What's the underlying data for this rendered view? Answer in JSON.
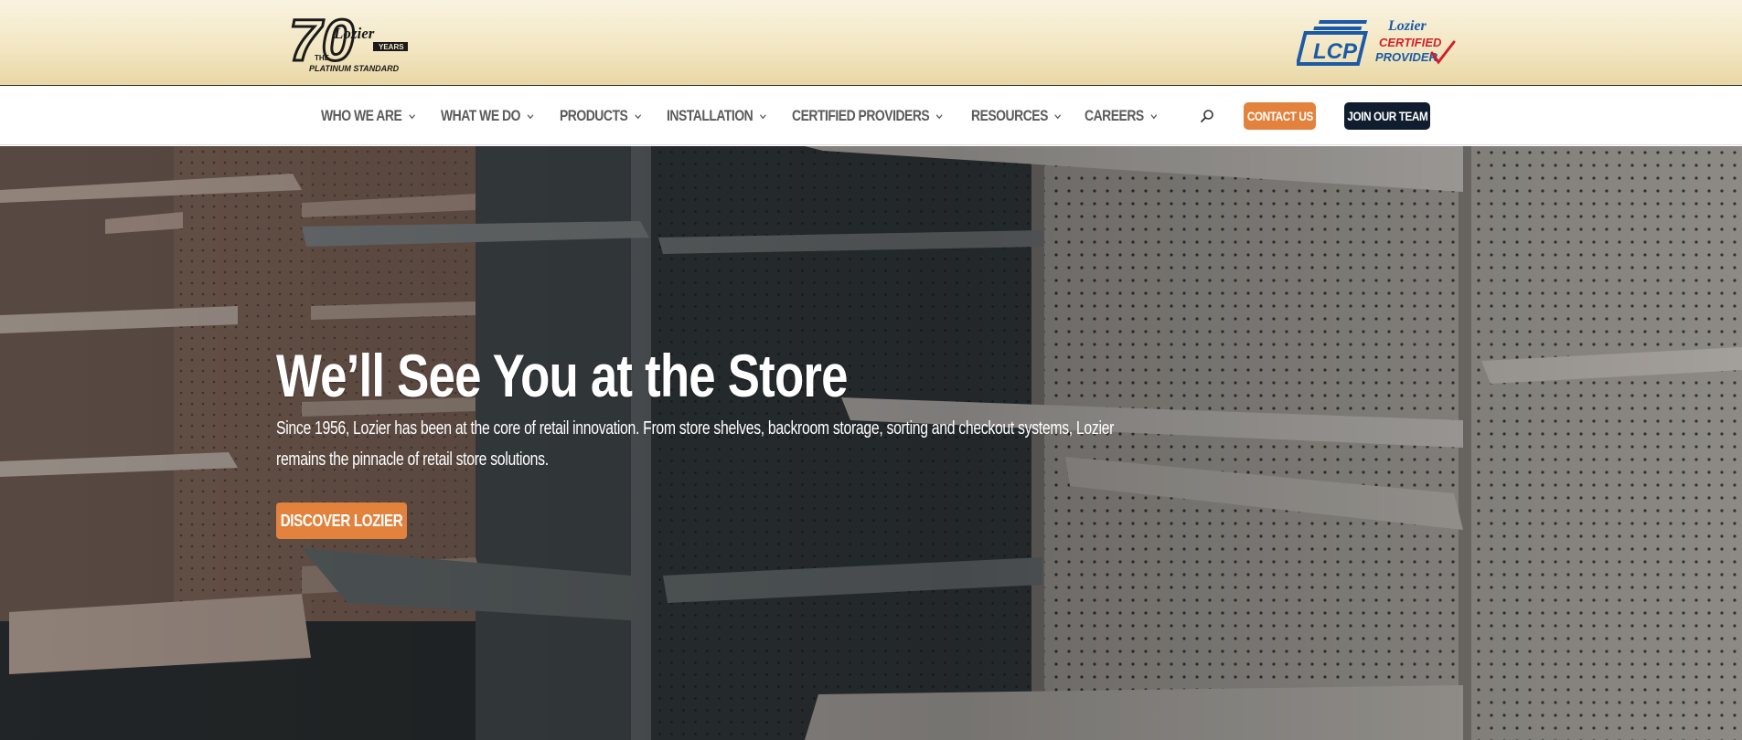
{
  "brand": {
    "logo_number": "70",
    "logo_name": "Lozier",
    "logo_years": "YEARS",
    "logo_the": "THE",
    "logo_tagline": "PLATINUM STANDARD",
    "lcp_initials": "LCP",
    "lcp_name": "Lozier",
    "lcp_line1": "CERTIFIED",
    "lcp_line2": "PROVIDER"
  },
  "nav": {
    "items": [
      {
        "label": "WHO WE ARE"
      },
      {
        "label": "WHAT WE DO"
      },
      {
        "label": "PRODUCTS"
      },
      {
        "label": "INSTALLATION"
      },
      {
        "label": "CERTIFIED PROVIDERS"
      },
      {
        "label": "RESOURCES"
      },
      {
        "label": "CAREERS"
      }
    ],
    "search_icon": "search-icon",
    "contact_label": "CONTACT US",
    "join_label": "JOIN OUR TEAM"
  },
  "hero": {
    "title": "We’ll See You at the Store",
    "subtitle": "Since 1956, Lozier has been at the core of retail innovation. From store shelves, backroom storage, sorting and checkout systems, Lozier remains the pinnacle of retail store solutions.",
    "cta_label": "DISCOVER LOZIER"
  },
  "colors": {
    "accent_orange": "#e2823d",
    "navy": "#0f1d2e",
    "nav_text": "#5b5b5b",
    "brand_bar": "#f3e7c3"
  }
}
